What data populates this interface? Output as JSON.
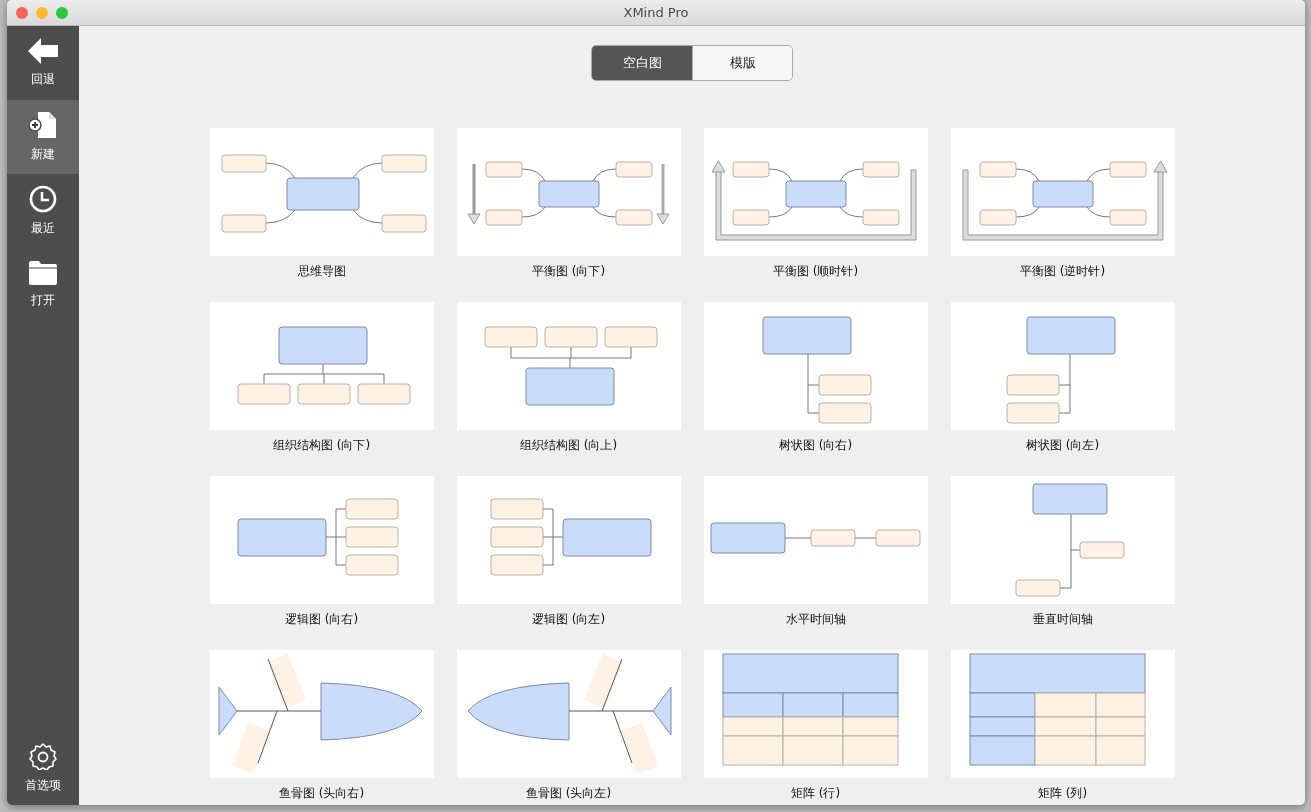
{
  "window": {
    "title": "XMind Pro"
  },
  "sidebar": {
    "items": [
      {
        "label": "回退",
        "kind": "back",
        "selected": false
      },
      {
        "label": "新建",
        "kind": "new",
        "selected": true
      },
      {
        "label": "最近",
        "kind": "recent",
        "selected": false
      },
      {
        "label": "打开",
        "kind": "open",
        "selected": false
      }
    ],
    "footer": {
      "label": "首选项",
      "kind": "settings"
    }
  },
  "segments": [
    {
      "label": "空白图",
      "selected": true
    },
    {
      "label": "模版",
      "selected": false
    }
  ],
  "templates": [
    {
      "label": "思维导图",
      "kind": "mindmap"
    },
    {
      "label": "平衡图 (向下)",
      "kind": "balance-down"
    },
    {
      "label": "平衡图 (顺时针)",
      "kind": "balance-cw"
    },
    {
      "label": "平衡图 (逆时针)",
      "kind": "balance-ccw"
    },
    {
      "label": "组织结构图 (向下)",
      "kind": "org-down"
    },
    {
      "label": "组织结构图 (向上)",
      "kind": "org-up"
    },
    {
      "label": "树状图 (向右)",
      "kind": "tree-right"
    },
    {
      "label": "树状图 (向左)",
      "kind": "tree-left"
    },
    {
      "label": "逻辑图 (向右)",
      "kind": "logic-right"
    },
    {
      "label": "逻辑图 (向左)",
      "kind": "logic-left"
    },
    {
      "label": "水平时间轴",
      "kind": "timeline-h"
    },
    {
      "label": "垂直时间轴",
      "kind": "timeline-v"
    },
    {
      "label": "鱼骨图 (头向右)",
      "kind": "fishbone-right"
    },
    {
      "label": "鱼骨图 (头向左)",
      "kind": "fishbone-left"
    },
    {
      "label": "矩阵 (行)",
      "kind": "matrix-row"
    },
    {
      "label": "矩阵 (列)",
      "kind": "matrix-col"
    }
  ]
}
